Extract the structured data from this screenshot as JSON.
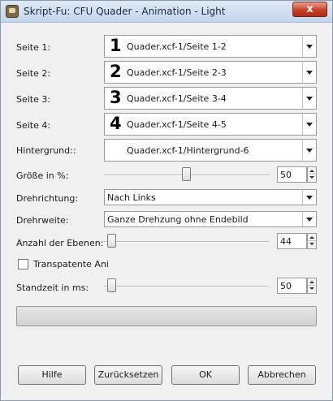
{
  "window": {
    "title": "Skript-Fu: CFU Quader - Animation - Light",
    "close_label": "x"
  },
  "pages": [
    {
      "label": "Seite 1:",
      "number": "1",
      "value": "Quader.xcf-1/Seite 1-2"
    },
    {
      "label": "Seite 2:",
      "number": "2",
      "value": "Quader.xcf-1/Seite 2-3"
    },
    {
      "label": "Seite 3:",
      "number": "3",
      "value": "Quader.xcf-1/Seite 3-4"
    },
    {
      "label": "Seite 4:",
      "number": "4",
      "value": "Quader.xcf-1/Seite 4-5"
    }
  ],
  "background": {
    "label": "Hintergrund::",
    "value": "Quader.xcf-1/Hintergrund-6"
  },
  "size": {
    "label": "Größe in %:",
    "value": "50",
    "slider_fraction": 0.5
  },
  "direction": {
    "label": "Drehrichtung:",
    "value": "Nach Links"
  },
  "rotation": {
    "label": "Drehrweite:",
    "value": "Ganze Drehzung ohne Endebild"
  },
  "layers": {
    "label": "Anzahl der Ebenen:",
    "value": "44",
    "slider_fraction": 0.02
  },
  "transparent": {
    "label": "Transpatente Ani",
    "checked": false
  },
  "duration": {
    "label": "Standzeit in ms:",
    "value": "50",
    "slider_fraction": 0.02
  },
  "progress": {
    "fraction": 0
  },
  "buttons": {
    "help": "Hilfe",
    "reset": "Zurücksetzen",
    "ok": "OK",
    "cancel": "Abbrechen"
  }
}
